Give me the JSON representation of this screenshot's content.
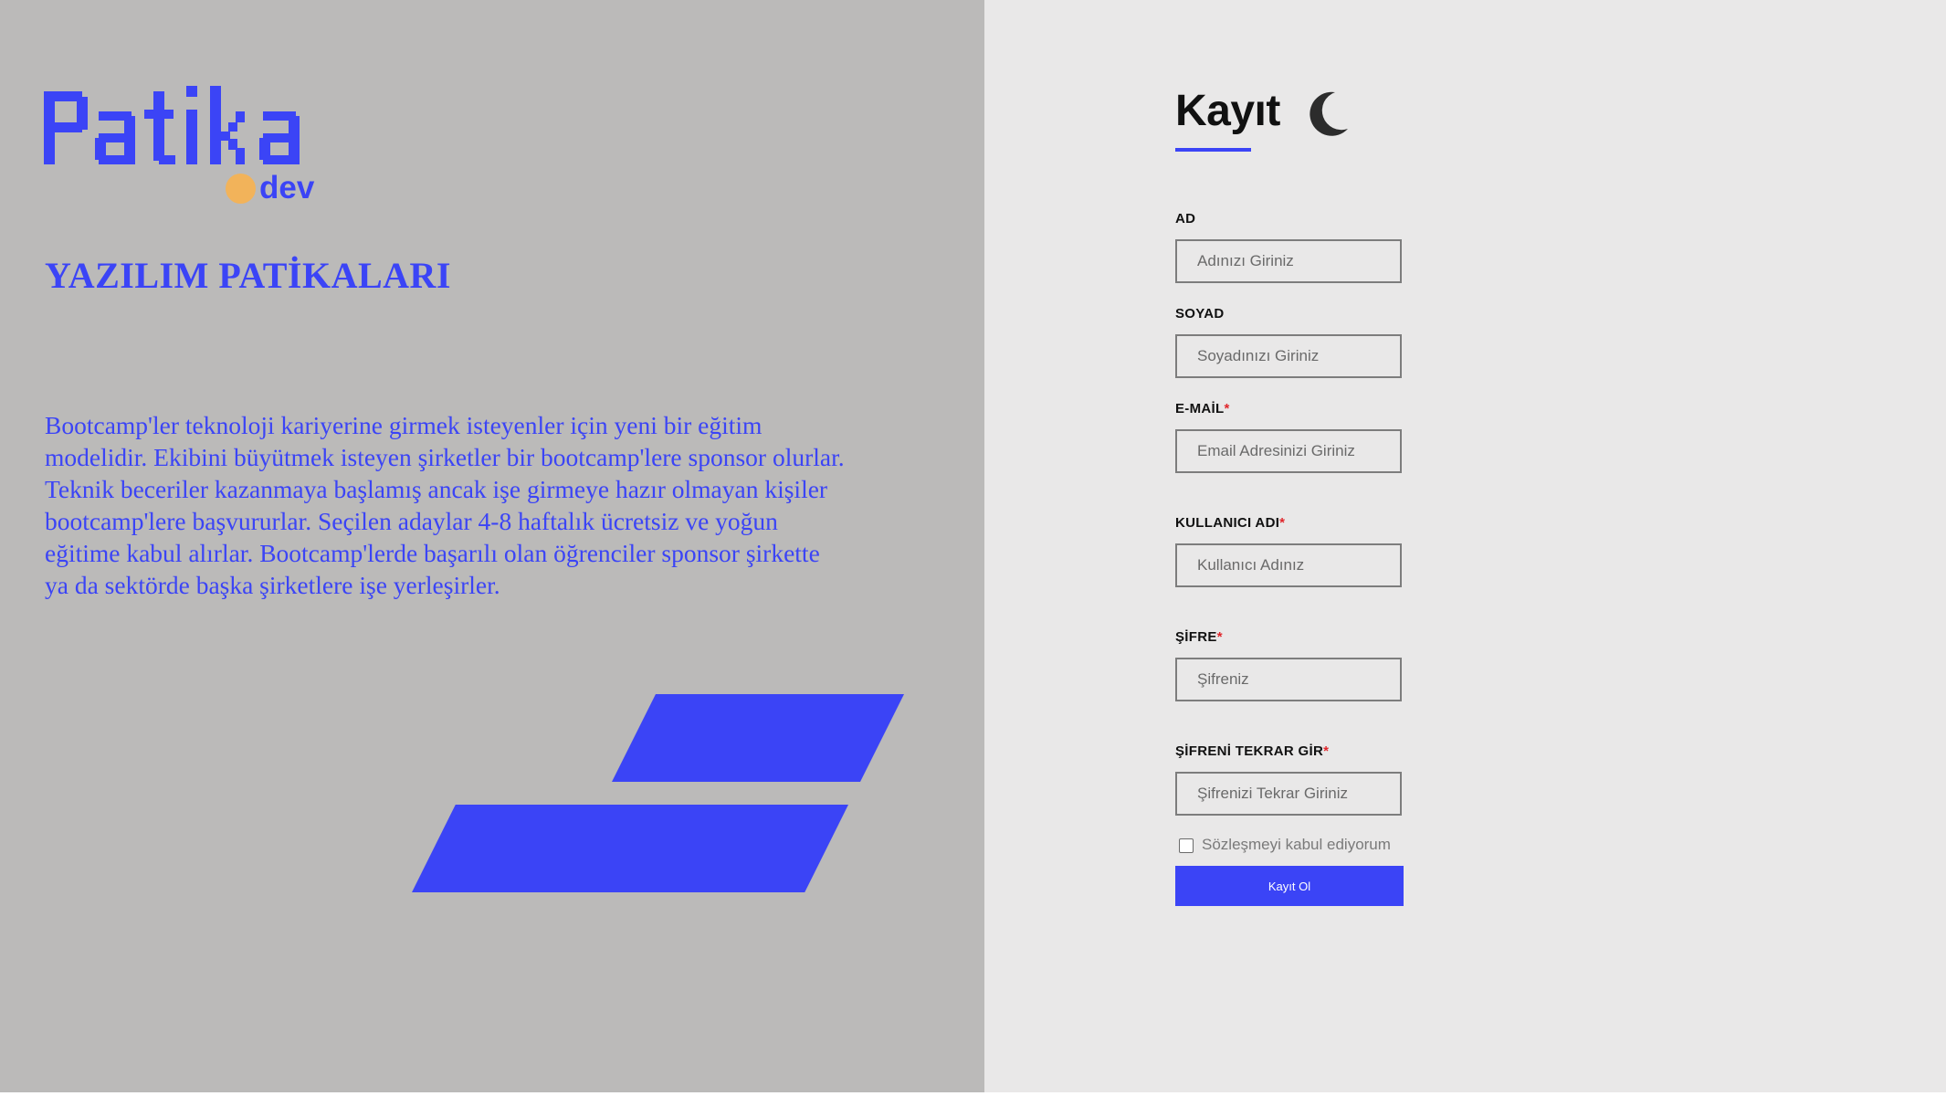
{
  "brand": {
    "logo_text": "Patika",
    "logo_sub": "dev",
    "accent_color": "#3b44f6",
    "dot_color": "#f2b35a"
  },
  "left": {
    "heading": "YAZILIM PATİKALARI",
    "paragraph": "Bootcamp'ler teknoloji kariyerine girmek isteyenler için yeni bir eğitim modelidir. Ekibini büyütmek isteyen şirketler bir bootcamp'lere sponsor olurlar. Teknik beceriler kazanmaya başlamış ancak işe girmeye hazır olmayan kişiler bootcamp'lere başvururlar. Seçilen adaylar 4-8 haftalık ücretsiz ve yoğun eğitime kabul alırlar. Bootcamp'lerde başarılı olan öğrenciler sponsor şirkette ya da sektörde başka şirketlere işe yerleşirler."
  },
  "form": {
    "title": "Kayıt",
    "theme_toggle_icon": "moon-icon",
    "fields": [
      {
        "label": "AD",
        "required": false,
        "placeholder": "Adınızı Giriniz"
      },
      {
        "label": "SOYAD",
        "required": false,
        "placeholder": "Soyadınızı Giriniz"
      },
      {
        "label": "E-MAİL",
        "required": true,
        "placeholder": "Email Adresinizi Giriniz"
      },
      {
        "label": "KULLANICI ADI",
        "required": true,
        "placeholder": "Kullanıcı Adınız"
      },
      {
        "label": "ŞİFRE",
        "required": true,
        "placeholder": "Şifreniz"
      },
      {
        "label": "ŞİFRENİ TEKRAR GİR",
        "required": true,
        "placeholder": "Şifrenizi Tekrar Giriniz"
      }
    ],
    "required_marker": "*",
    "checkbox_label": "Sözleşmeyi kabul ediyorum",
    "checkbox_checked": false,
    "submit_label": "Kayıt Ol"
  }
}
